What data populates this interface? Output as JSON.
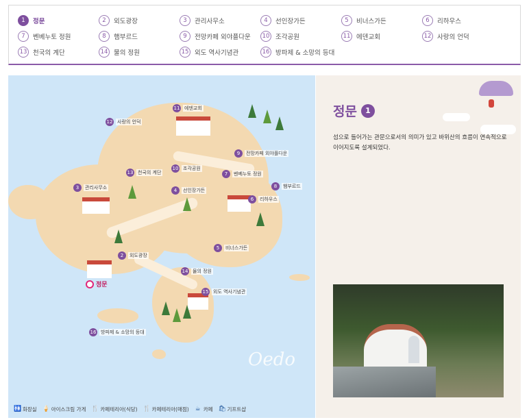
{
  "legend": {
    "items": [
      {
        "num": "1",
        "label": "정문"
      },
      {
        "num": "2",
        "label": "외도광장"
      },
      {
        "num": "3",
        "label": "관리사무소"
      },
      {
        "num": "4",
        "label": "선인장가든"
      },
      {
        "num": "5",
        "label": "비너스가든"
      },
      {
        "num": "6",
        "label": "리하우스"
      },
      {
        "num": "7",
        "label": "벤베누토 정원"
      },
      {
        "num": "8",
        "label": "햄부르드"
      },
      {
        "num": "9",
        "label": "전망카페 외야플다운"
      },
      {
        "num": "10",
        "label": "조각공원"
      },
      {
        "num": "11",
        "label": "에덴교회"
      },
      {
        "num": "12",
        "label": "사랑의 언덕"
      },
      {
        "num": "13",
        "label": "천국의 계단"
      },
      {
        "num": "14",
        "label": "물의 정원"
      },
      {
        "num": "15",
        "label": "외도 역사기념관"
      },
      {
        "num": "16",
        "label": "방파제 & 소망의 등대"
      }
    ]
  },
  "map": {
    "gate_label": "정문",
    "watermark": "Oedo",
    "pins": [
      {
        "num": "11",
        "label": "에덴교회"
      },
      {
        "num": "12",
        "label": "사랑의 언덕"
      },
      {
        "num": "9",
        "label": "전망카페 외야플다운"
      },
      {
        "num": "13",
        "label": "천국의 계단"
      },
      {
        "num": "10",
        "label": "조각공원"
      },
      {
        "num": "7",
        "label": "벤베누토 정원"
      },
      {
        "num": "3",
        "label": "관리사무소"
      },
      {
        "num": "4",
        "label": "선인장가든"
      },
      {
        "num": "8",
        "label": "햄부르드"
      },
      {
        "num": "6",
        "label": "리하우스"
      },
      {
        "num": "5",
        "label": "비너스가든"
      },
      {
        "num": "2",
        "label": "외도광장"
      },
      {
        "num": "14",
        "label": "물의 정원"
      },
      {
        "num": "15",
        "label": "외도 역사기념관"
      },
      {
        "num": "16",
        "label": "방파제 & 소망의 등대"
      }
    ],
    "facility_legend": [
      {
        "icon": "restroom-icon",
        "glyph": "🚻",
        "label": "화장실"
      },
      {
        "icon": "ice-cream-icon",
        "glyph": "🍦",
        "label": "아이스크림 가게"
      },
      {
        "icon": "cafeteria-food-icon",
        "glyph": "🍴",
        "label": "카페테리아(식당)"
      },
      {
        "icon": "cafeteria-shop-icon",
        "glyph": "🍴",
        "label": "카페테리아(매점)"
      },
      {
        "icon": "cafe-icon",
        "glyph": "☕",
        "label": "카페"
      },
      {
        "icon": "gift-shop-icon",
        "glyph": "🛍",
        "label": "기프트샵"
      }
    ]
  },
  "detail": {
    "title": "정문",
    "num": "1",
    "description": "섬으로 들어가는 관문으로서의 의미가 있고 바위산의 흐름이 연속적으로 이어지도록 설계되었다."
  },
  "colors": {
    "accent": "#7e4f9e",
    "sea": "#cfe6f8",
    "land": "#f3d9b1"
  }
}
